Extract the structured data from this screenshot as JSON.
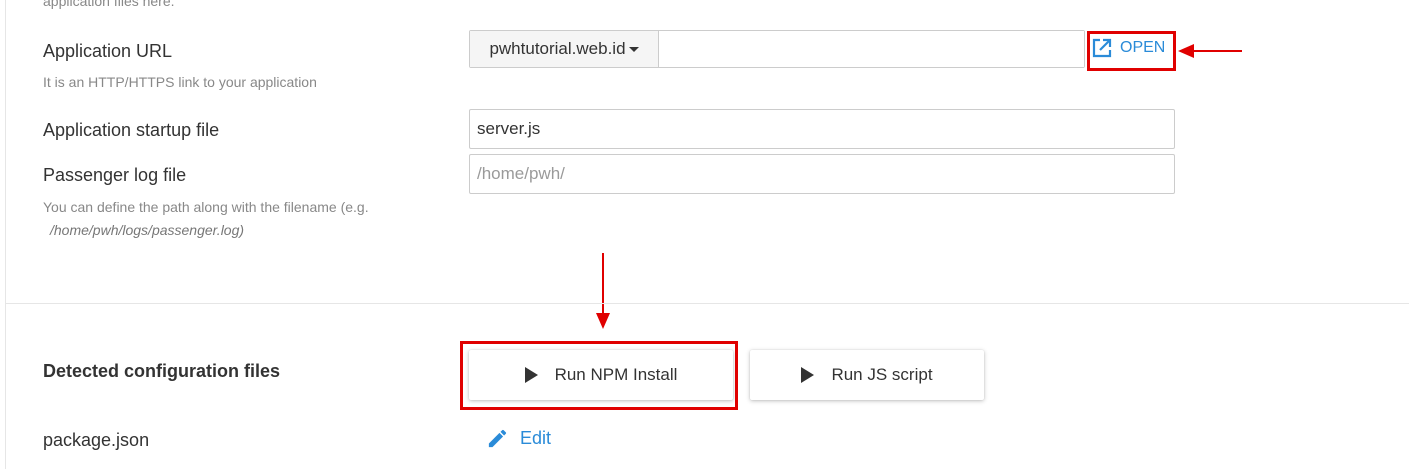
{
  "form": {
    "top_hint_cut": "application files here.",
    "application_url": {
      "label": "Application URL",
      "hint": "It is an HTTP/HTTPS link to your application",
      "domain": "pwhtutorial.web.id",
      "path_value": "",
      "open_label": "OPEN"
    },
    "startup_file": {
      "label": "Application startup file",
      "value": "server.js"
    },
    "passenger_log": {
      "label": "Passenger log file",
      "placeholder": "/home/pwh/",
      "hint": "You can define the path along with the filename (e.g.",
      "hint_example": "/home/pwh/logs/passenger.log)"
    }
  },
  "config": {
    "title": "Detected configuration files",
    "run_npm_label": "Run NPM Install",
    "run_js_label": "Run JS script",
    "files": [
      {
        "name": "package.json",
        "edit_label": "Edit"
      }
    ]
  },
  "icons": {
    "open": "external-link-icon",
    "run": "play-icon",
    "edit": "pencil-icon",
    "dropdown": "caret-down-icon"
  },
  "colors": {
    "accent": "#2a8bd8",
    "highlight": "#e00000"
  }
}
